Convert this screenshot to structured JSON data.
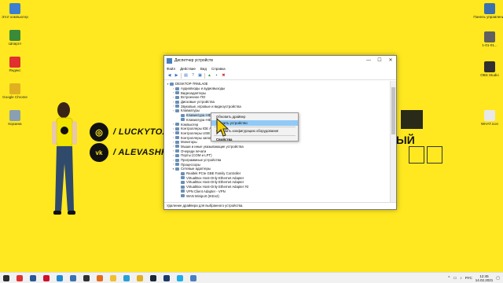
{
  "desktop_icons": {
    "left": [
      {
        "label": "Этот компьютер",
        "color": "#3c7fd0"
      },
      {
        "label": "Шпаргл",
        "color": "#3a8a3a"
      },
      {
        "label": "Яндекс",
        "color": "#e03030"
      },
      {
        "label": "Google Chrome",
        "color": "#e0b020"
      },
      {
        "label": "Корзина",
        "color": "#8aa0b0"
      }
    ],
    "right": [
      {
        "label": "Панель управления",
        "color": "#3a6fb0"
      },
      {
        "label": "1-01-01...",
        "color": "#606060"
      },
      {
        "label": "OBS Studio",
        "color": "#303030"
      },
      {
        "label": "WHAT.icon",
        "color": "#e8e8e8"
      }
    ]
  },
  "wallpaper": {
    "social": [
      {
        "icon": "instagram-icon",
        "glyph": "◎",
        "text": "/ LUCKYTOXI"
      },
      {
        "icon": "vk-icon",
        "glyph": "vk",
        "text": "/ ALEVASHK"
      }
    ],
    "right_text": "ЫЙ"
  },
  "window": {
    "title": "Диспетчер устройств",
    "controls": [
      "—",
      "☐",
      "✕"
    ],
    "menu": [
      "Файл",
      "Действие",
      "Вид",
      "Справка"
    ],
    "toolbar_icons": [
      "back-icon",
      "forward-icon",
      "properties-icon",
      "help-icon",
      "scan-icon",
      "update-driver-icon",
      "disable-icon",
      "uninstall-icon"
    ],
    "tree": [
      {
        "level": 0,
        "arrow": "▾",
        "label": "DESKTOP-7RMLA0E",
        "selected": false
      },
      {
        "level": 1,
        "arrow": "›",
        "label": "Аудиовходы и аудиовыходы",
        "selected": false
      },
      {
        "level": 1,
        "arrow": "›",
        "label": "Видеоадаптеры",
        "selected": false
      },
      {
        "level": 1,
        "arrow": "›",
        "label": "Встроенное ПО",
        "selected": false
      },
      {
        "level": 1,
        "arrow": "›",
        "label": "Дисковые устройства",
        "selected": false
      },
      {
        "level": 1,
        "arrow": "›",
        "label": "Звуковые, игровые и видеоустройства",
        "selected": false
      },
      {
        "level": 1,
        "arrow": "›",
        "label": "Клавиатуры",
        "selected": false
      },
      {
        "level": 2,
        "arrow": "",
        "label": "Клавиатура HID",
        "selected": true
      },
      {
        "level": 2,
        "arrow": "",
        "label": "Клавиатура HID",
        "selected": false
      },
      {
        "level": 1,
        "arrow": "›",
        "label": "Компьютер",
        "selected": false
      },
      {
        "level": 1,
        "arrow": "›",
        "label": "Контроллеры IDE ATA/ATAPI",
        "selected": false
      },
      {
        "level": 1,
        "arrow": "›",
        "label": "Контроллеры USB",
        "selected": false
      },
      {
        "level": 1,
        "arrow": "›",
        "label": "Контроллеры запоминающих устройств",
        "selected": false
      },
      {
        "level": 1,
        "arrow": "›",
        "label": "Мониторы",
        "selected": false
      },
      {
        "level": 1,
        "arrow": "›",
        "label": "Мыши и иные указывающие устройства",
        "selected": false
      },
      {
        "level": 1,
        "arrow": "›",
        "label": "Очереди печати",
        "selected": false
      },
      {
        "level": 1,
        "arrow": "›",
        "label": "Порты (COM и LPT)",
        "selected": false
      },
      {
        "level": 1,
        "arrow": "›",
        "label": "Программные устройства",
        "selected": false
      },
      {
        "level": 1,
        "arrow": "›",
        "label": "Процессоры",
        "selected": false
      },
      {
        "level": 1,
        "arrow": "▾",
        "label": "Сетевые адаптеры",
        "selected": false
      },
      {
        "level": 2,
        "arrow": "",
        "label": "Realtek PCIe GBE Family Controller",
        "selected": false
      },
      {
        "level": 2,
        "arrow": "",
        "label": "VirtualBox Host-Only Ethernet Adapter",
        "selected": false
      },
      {
        "level": 2,
        "arrow": "",
        "label": "VirtualBox Host-Only Ethernet Adapter",
        "selected": false
      },
      {
        "level": 2,
        "arrow": "",
        "label": "VirtualBox Host-Only Ethernet Adapter #2",
        "selected": false
      },
      {
        "level": 2,
        "arrow": "",
        "label": "VPN Client Adapter - VPN",
        "selected": false
      },
      {
        "level": 2,
        "arrow": "",
        "label": "WAN Miniport (IKEv2)",
        "selected": false
      }
    ],
    "status": "Удаление драйвера для выбранного устройства."
  },
  "context_menu": {
    "items": [
      {
        "label": "Обновить драйвер",
        "highlighted": false,
        "bold": false
      },
      {
        "label": "Удалить устройство",
        "highlighted": true,
        "bold": false
      },
      {
        "label": "Обновить конфигурацию оборудования",
        "highlighted": false,
        "bold": false
      },
      {
        "label": "Свойства",
        "highlighted": false,
        "bold": true
      }
    ]
  },
  "taskbar": {
    "apps": [
      {
        "icon": "start-icon",
        "color": "#2b2b2b"
      },
      {
        "icon": "yandex-icon",
        "color": "#e03030"
      },
      {
        "icon": "word-icon",
        "color": "#2b5797"
      },
      {
        "icon": "opera-icon",
        "color": "#d0102a"
      },
      {
        "icon": "edge-icon",
        "color": "#1f8ad0"
      },
      {
        "icon": "vk-app-icon",
        "color": "#3a72b0"
      },
      {
        "icon": "obs-icon",
        "color": "#303030"
      },
      {
        "icon": "media-icon",
        "color": "#e36c1a"
      },
      {
        "icon": "explorer-icon",
        "color": "#f0c030"
      },
      {
        "icon": "telegram-icon",
        "color": "#2aa0d8"
      },
      {
        "icon": "chrome-icon",
        "color": "#e0b020"
      },
      {
        "icon": "steam-icon",
        "color": "#1b2838"
      },
      {
        "icon": "photoshop-icon",
        "color": "#1b3a6a"
      },
      {
        "icon": "skype-icon",
        "color": "#1faee9"
      },
      {
        "icon": "device-manager-icon",
        "color": "#4a7fbf"
      }
    ],
    "lang": "РУС",
    "time": "12:45",
    "date": "14.02.2021"
  }
}
